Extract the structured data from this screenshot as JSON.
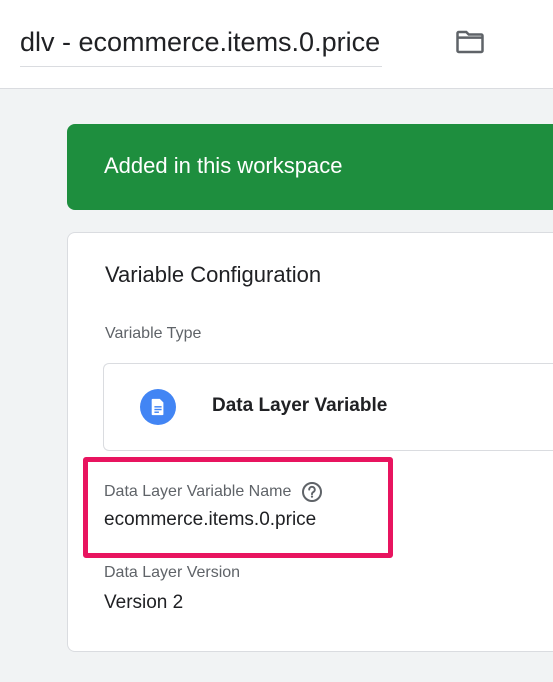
{
  "header": {
    "title": "dlv - ecommerce.items.0.price",
    "folder_icon": "folder-icon"
  },
  "banner": {
    "text": "Added in this workspace",
    "color": "#1e8e3e"
  },
  "config": {
    "title": "Variable Configuration",
    "type_label": "Variable Type",
    "type_name": "Data Layer Variable",
    "type_icon": "document-icon",
    "name_label": "Data Layer Variable Name",
    "help_icon": "help-icon",
    "name_value": "ecommerce.items.0.price",
    "version_label": "Data Layer Version",
    "version_value": "Version 2"
  },
  "colors": {
    "accent_blue": "#4285f4",
    "highlight": "#e8145f"
  }
}
